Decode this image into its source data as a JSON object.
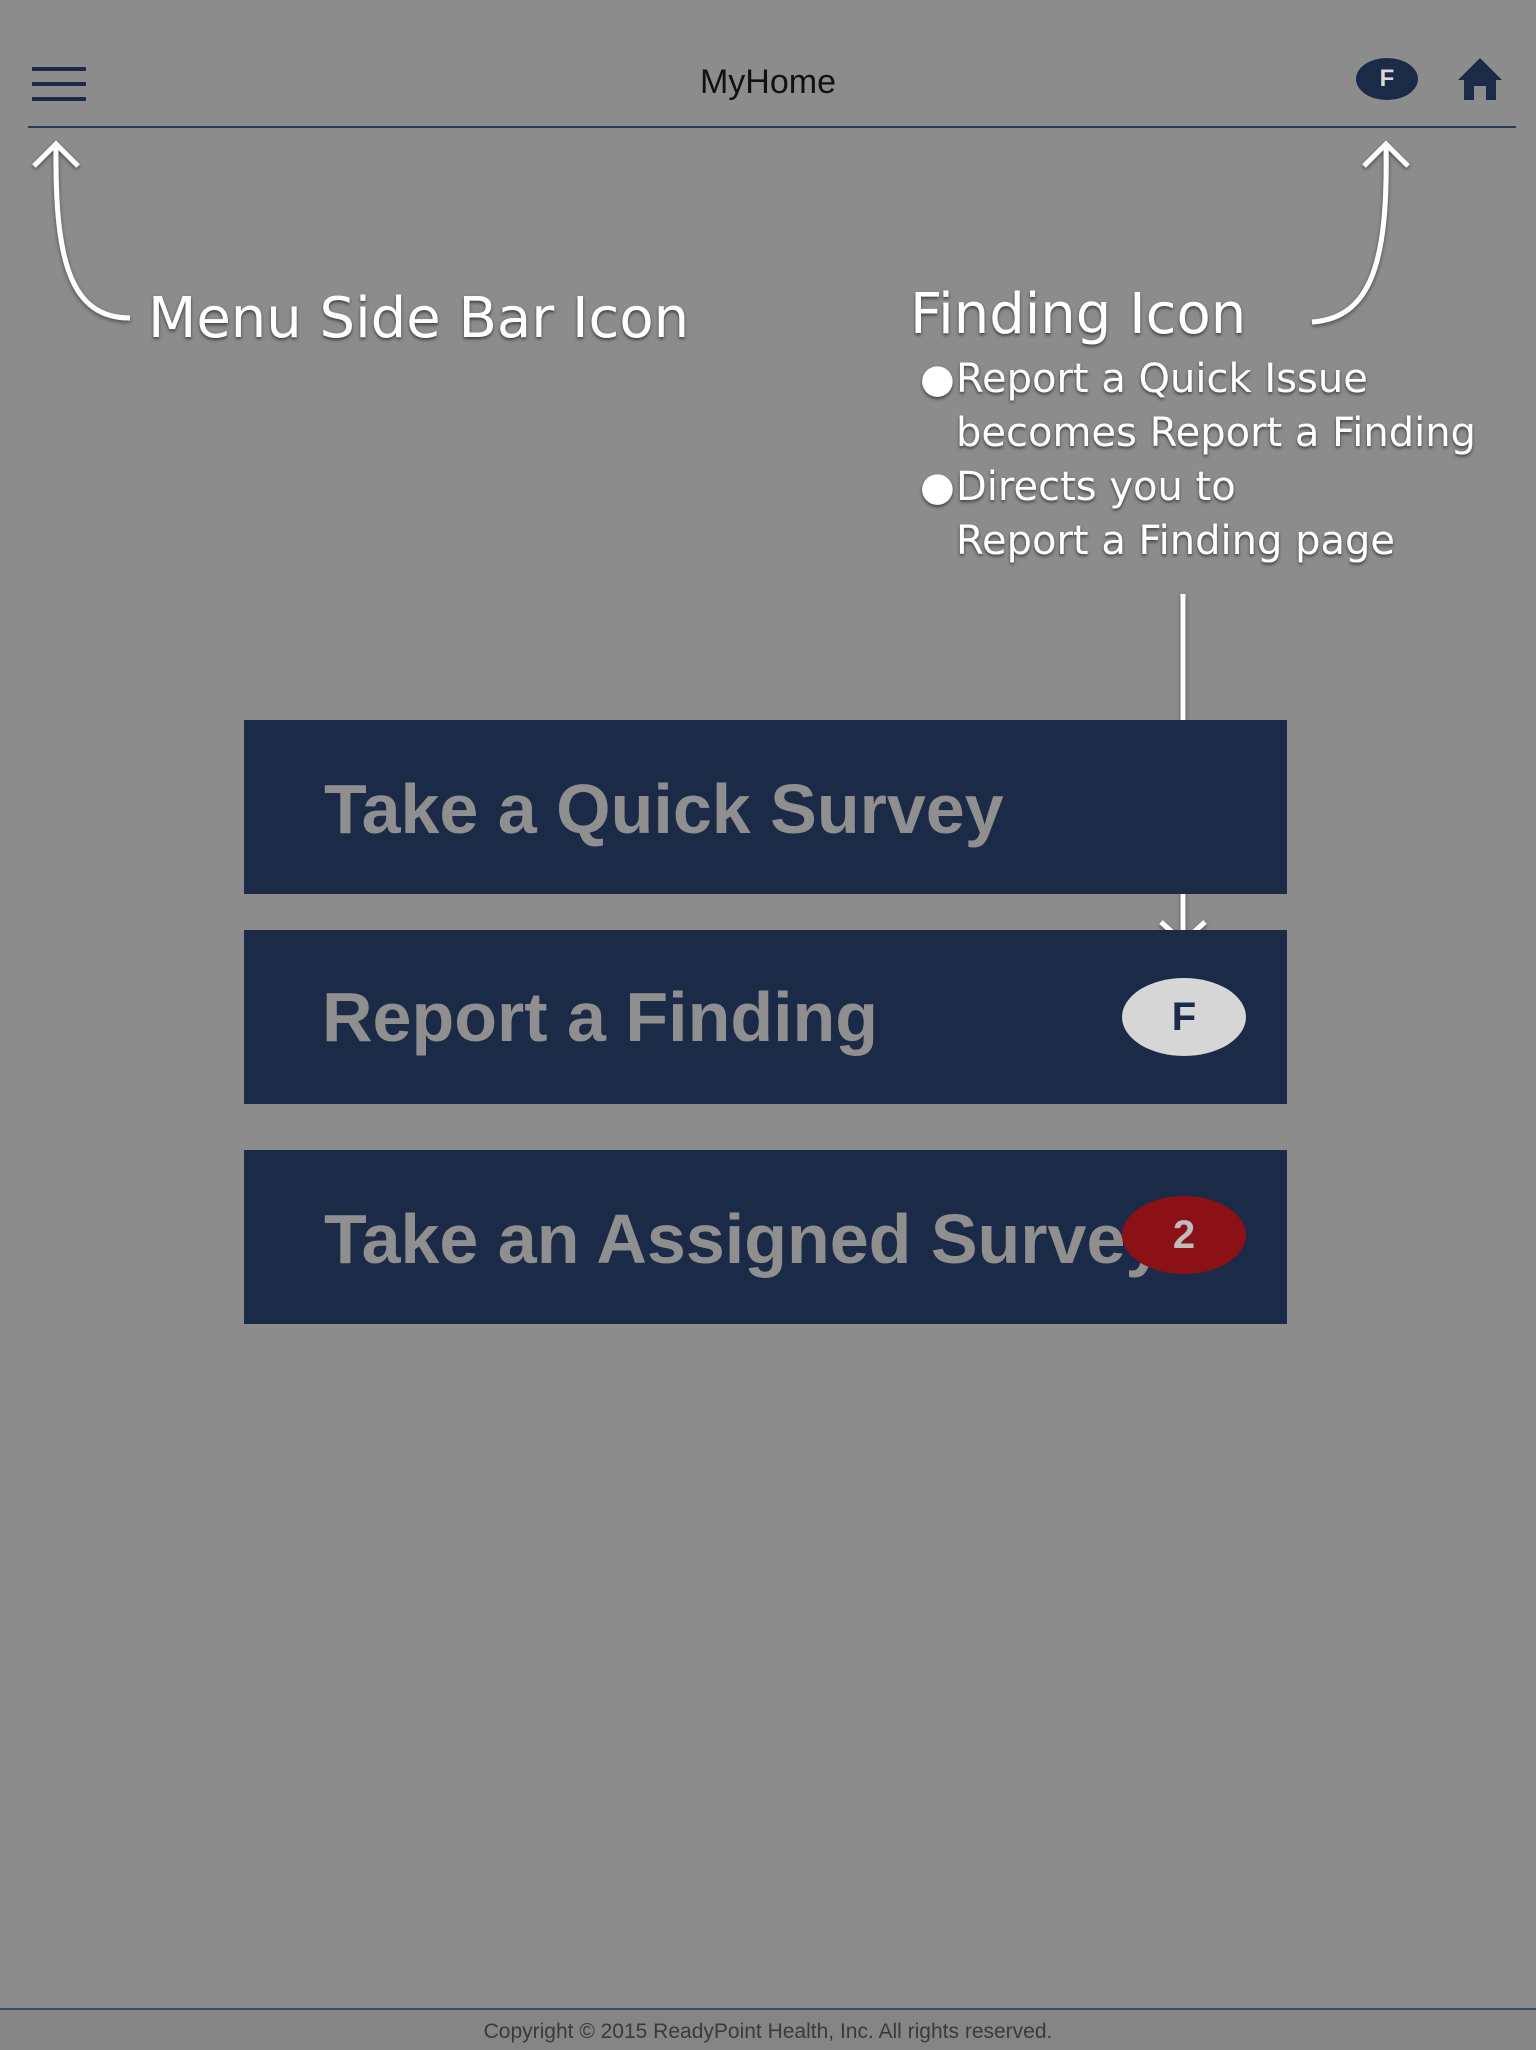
{
  "header": {
    "title": "MyHome",
    "finding_badge": "F",
    "menu_icon": "hamburger-menu-icon",
    "home_icon": "home-icon"
  },
  "annotations": {
    "menu": "Menu Side Bar Icon",
    "finding_title": "Finding Icon",
    "bullets": [
      {
        "first": "Report a Quick Issue",
        "second": "becomes Report a Finding"
      },
      {
        "first": "Directs you to",
        "second": "Report a Finding page"
      }
    ]
  },
  "actions": [
    {
      "label": "Take a Quick Survey"
    },
    {
      "label": "Report a Finding",
      "badge": "F"
    },
    {
      "label": "Take an Assigned Survey",
      "badge": "2"
    }
  ],
  "footer": {
    "copyright": "Copyright © 2015 ReadyPoint Health, Inc. All rights reserved."
  },
  "colors": {
    "background": "#8c8c8c",
    "navy": "#1b2a47",
    "badge_red": "#8b1117",
    "annotation": "#ffffff"
  }
}
